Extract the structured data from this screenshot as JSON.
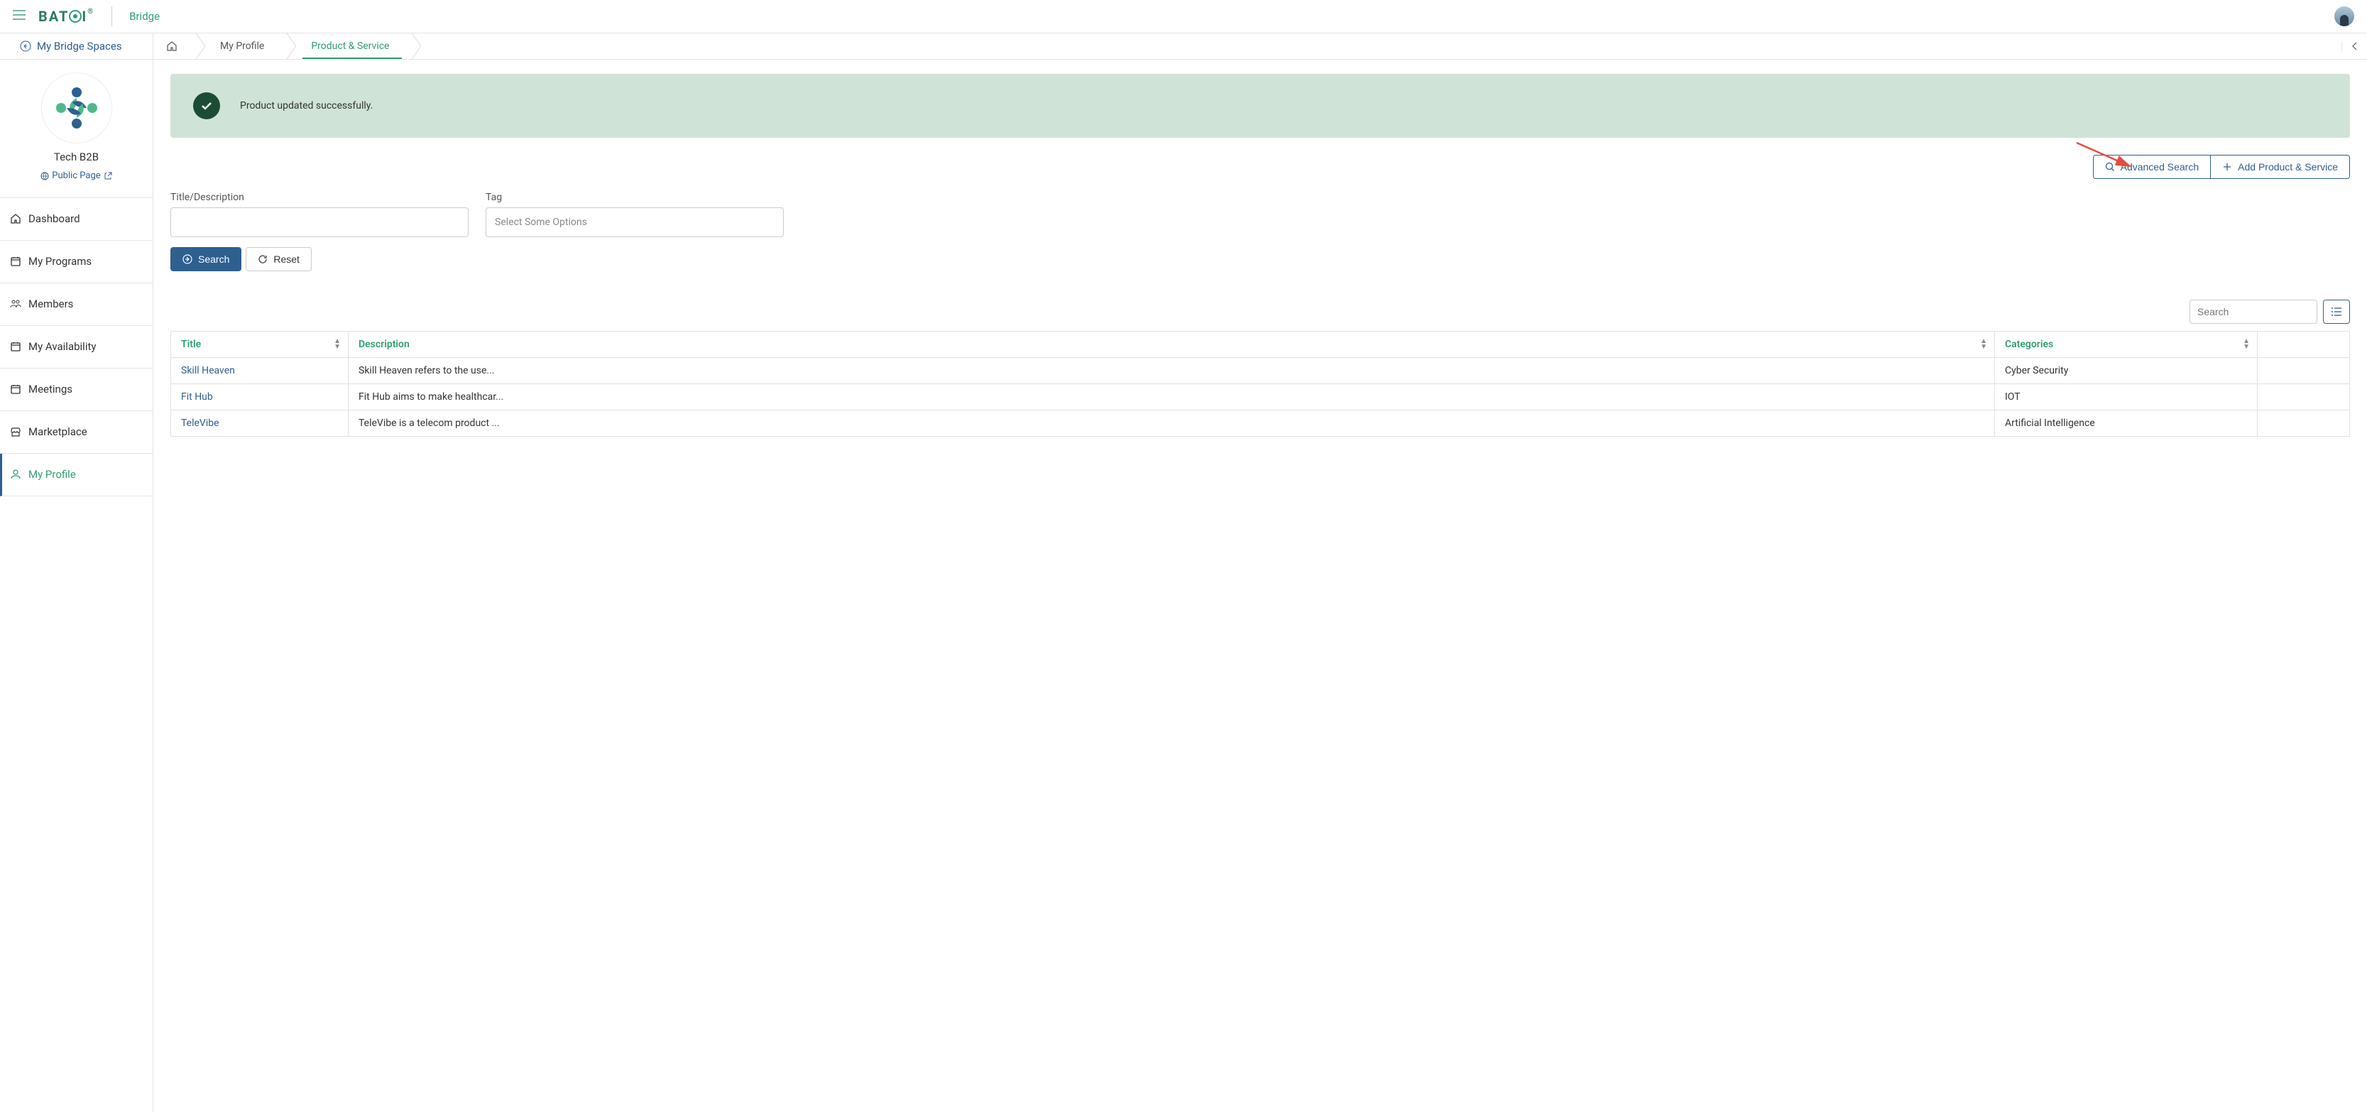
{
  "header": {
    "logo_text": "BAT",
    "logo_suffix": "I",
    "bridge_label": "Bridge"
  },
  "breadcrumb": {
    "back_label": "My Bridge Spaces",
    "items": [
      "My Profile",
      "Product & Service"
    ]
  },
  "sidebar": {
    "org_name": "Tech B2B",
    "public_page_label": "Public Page",
    "nav": [
      {
        "label": "Dashboard"
      },
      {
        "label": "My Programs"
      },
      {
        "label": "Members"
      },
      {
        "label": "My Availability"
      },
      {
        "label": "Meetings"
      },
      {
        "label": "Marketplace"
      },
      {
        "label": "My Profile"
      }
    ]
  },
  "alert": {
    "message": "Product updated successfully."
  },
  "actions": {
    "advanced_search": "Advanced Search",
    "add_product": "Add Product & Service"
  },
  "filters": {
    "title_label": "Title/Description",
    "tag_label": "Tag",
    "tag_placeholder": "Select Some Options",
    "search_btn": "Search",
    "reset_btn": "Reset"
  },
  "table": {
    "search_placeholder": "Search",
    "headers": {
      "title": "Title",
      "description": "Description",
      "categories": "Categories"
    },
    "rows": [
      {
        "title": "Skill Heaven",
        "description": "Skill Heaven refers to the use...",
        "categories": "Cyber Security"
      },
      {
        "title": "Fit Hub",
        "description": "Fit Hub aims to make healthcar...",
        "categories": "IOT"
      },
      {
        "title": "TeleVibe",
        "description": "TeleVibe is a telecom product ...",
        "categories": "Artificial Intelligence"
      }
    ]
  }
}
